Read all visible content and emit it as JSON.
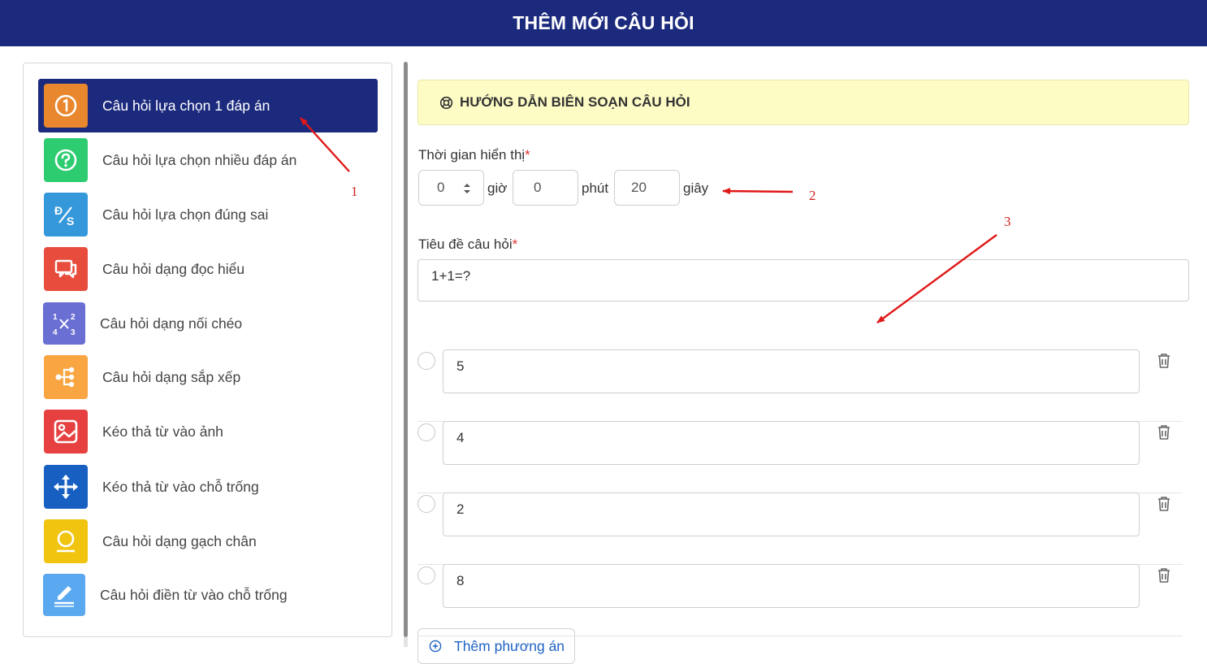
{
  "header": {
    "title": "THÊM MỚI CÂU HỎI"
  },
  "sidebar": {
    "items": [
      {
        "label": "Câu hỏi lựa chọn 1 đáp án",
        "icon": "number-one-icon",
        "color": "#e8872d",
        "active": true
      },
      {
        "label": "Câu hỏi lựa chọn nhiều đáp án",
        "icon": "question-circle-icon",
        "color": "#2ecc71",
        "active": false
      },
      {
        "label": "Câu hỏi lựa chọn đúng sai",
        "icon": "true-false-icon",
        "color": "#3598db",
        "active": false
      },
      {
        "label": "Câu hỏi dạng đọc hiểu",
        "icon": "chat-bubbles-icon",
        "color": "#e74c3c",
        "active": false
      },
      {
        "label": "Câu hỏi dạng nối chéo",
        "icon": "cross-match-icon",
        "color": "#6a6fd3",
        "active": false
      },
      {
        "label": "Câu hỏi dạng sắp xếp",
        "icon": "sort-tree-icon",
        "color": "#f9a541",
        "active": false
      },
      {
        "label": "Kéo thả từ vào ảnh",
        "icon": "image-icon",
        "color": "#e64040",
        "active": false
      },
      {
        "label": "Kéo thả từ vào chỗ trống",
        "icon": "move-arrows-icon",
        "color": "#1760c2",
        "active": false
      },
      {
        "label": "Câu hỏi dạng gạch chân",
        "icon": "underline-circle-icon",
        "color": "#f1c40f",
        "active": false
      },
      {
        "label": "Câu hỏi điền từ vào chỗ trống",
        "icon": "pencil-icon",
        "color": "#5aa9f0",
        "active": false
      }
    ]
  },
  "guide": {
    "label": "HƯỚNG DẪN BIÊN SOẠN CÂU HỎI",
    "icon": "life-ring-icon"
  },
  "time": {
    "label": "Thời gian hiển thị",
    "required_mark": "*",
    "hours": "0",
    "hours_unit": "giờ",
    "minutes": "0",
    "minutes_unit": "phút",
    "seconds": "20",
    "seconds_unit": "giây"
  },
  "question": {
    "label": "Tiêu đề câu hỏi",
    "required_mark": "*",
    "value": "1+1=?"
  },
  "answers": [
    {
      "value": "5"
    },
    {
      "value": "4"
    },
    {
      "value": "2"
    },
    {
      "value": "8"
    }
  ],
  "add_option": {
    "label": "Thêm phương án",
    "icon": "plus-circle-icon"
  },
  "annotations": [
    {
      "number": "1"
    },
    {
      "number": "2"
    },
    {
      "number": "3"
    }
  ],
  "colors": {
    "header_bg": "#1c2a7d",
    "guide_bg": "#fefcc5",
    "annotation": "#e01818",
    "link": "#1f63c4"
  }
}
